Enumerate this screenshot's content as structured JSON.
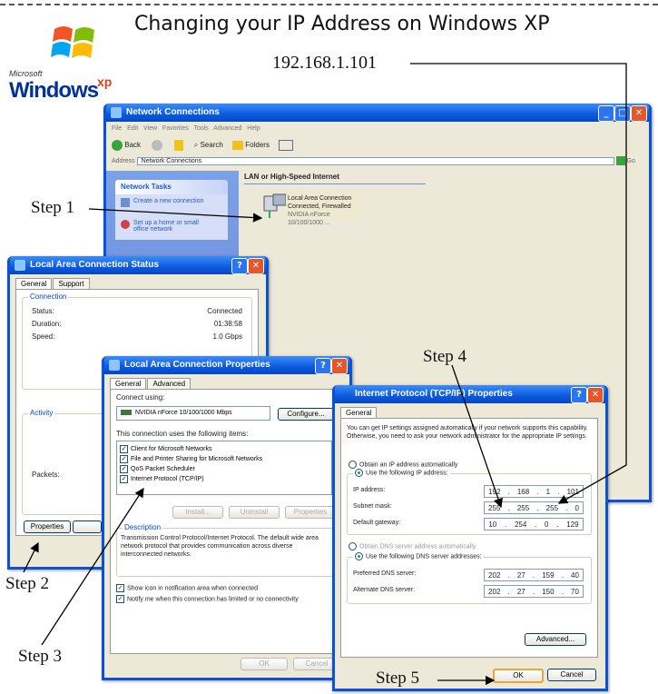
{
  "header": {
    "title": "Changing your IP Address on Windows XP",
    "ip_caption": "192.168.1.101",
    "logo_microsoft": "Microsoft",
    "logo_windows": "Windows",
    "logo_xp": "xp"
  },
  "steps": [
    "Step 1",
    "Step 2",
    "Step 3",
    "Step 4",
    "Step 5"
  ],
  "network_connections": {
    "title": "Network Connections",
    "menu": [
      "File",
      "Edit",
      "View",
      "Favorites",
      "Tools",
      "Advanced",
      "Help"
    ],
    "toolbar": {
      "back": "Back",
      "search": "Search",
      "folders": "Folders"
    },
    "address_label": "Address",
    "address_value": "Network Connections",
    "go": "Go",
    "tasks_title": "Network Tasks",
    "tasks": [
      "Create a new connection",
      "Set up a home or small office network"
    ],
    "section": "LAN or High-Speed Internet",
    "conn_name": "Local Area Connection",
    "conn_status": "Connected, Firewalled",
    "conn_device": "NVIDIA nForce 10/100/1000 ..."
  },
  "status_dialog": {
    "title": "Local Area Connection Status",
    "tabs": [
      "General",
      "Support"
    ],
    "group_connection": "Connection",
    "rows": [
      {
        "label": "Status:",
        "value": "Connected"
      },
      {
        "label": "Duration:",
        "value": "01:38:58"
      },
      {
        "label": "Speed:",
        "value": "1.0 Gbps"
      }
    ],
    "group_activity": "Activity",
    "packets": "Packets:",
    "properties_btn": "Properties"
  },
  "props_dialog": {
    "title": "Local Area Connection Properties",
    "tabs": [
      "General",
      "Advanced"
    ],
    "connect_using": "Connect using:",
    "adapter": "NVIDIA nForce 10/100/1000 Mbps",
    "configure": "Configure...",
    "items_label": "This connection uses the following items:",
    "items": [
      "Client for Microsoft Networks",
      "File and Printer Sharing for Microsoft Networks",
      "QoS Packet Scheduler",
      "Internet Protocol (TCP/IP)"
    ],
    "install": "Install...",
    "uninstall": "Uninstall",
    "properties": "Properties",
    "description_label": "Description",
    "description": "Transmission Control Protocol/Internet Protocol. The default wide area network protocol that provides communication across diverse interconnected networks.",
    "show_icon": "Show icon in notification area when connected",
    "notify": "Notify me when this connection has limited or no connectivity",
    "ok": "OK",
    "cancel": "Cancel"
  },
  "tcpip_dialog": {
    "title": "Internet Protocol (TCP/IP) Properties",
    "tab": "General",
    "intro": "You can get IP settings assigned automatically if your network supports this capability. Otherwise, you need to ask your network administrator for the appropriate IP settings.",
    "obtain_auto": "Obtain an IP address automatically",
    "use_following": "Use the following IP address:",
    "ip_label": "IP address:",
    "ip": [
      "192",
      "168",
      "1",
      "101"
    ],
    "mask_label": "Subnet mask:",
    "mask": [
      "255",
      "255",
      "255",
      "0"
    ],
    "gw_label": "Default gateway:",
    "gw": [
      "10",
      "254",
      "0",
      "129"
    ],
    "dns_auto": "Obtain DNS server address automatically",
    "dns_use": "Use the following DNS server addresses:",
    "pref_label": "Preferred DNS server:",
    "pref": [
      "202",
      "27",
      "159",
      "40"
    ],
    "alt_label": "Alternate DNS server:",
    "alt": [
      "202",
      "27",
      "150",
      "70"
    ],
    "advanced": "Advanced...",
    "ok": "OK",
    "cancel": "Cancel"
  }
}
